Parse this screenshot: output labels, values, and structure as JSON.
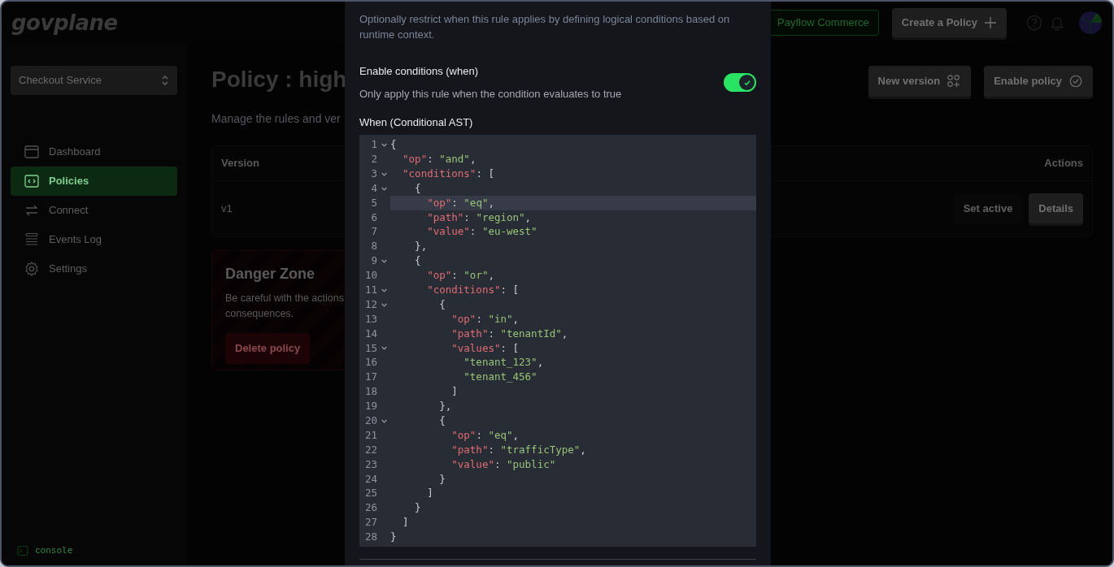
{
  "header": {
    "logo": "govplane",
    "org_badge": "Payflow Commerce",
    "create_button": "Create a Policy"
  },
  "sidebar": {
    "project_select": "Checkout Service",
    "items": [
      {
        "label": "Dashboard",
        "selected": false
      },
      {
        "label": "Policies",
        "selected": true
      },
      {
        "label": "Connect",
        "selected": false
      },
      {
        "label": "Events Log",
        "selected": false
      },
      {
        "label": "Settings",
        "selected": false
      }
    ],
    "console": "console"
  },
  "main": {
    "title": "Policy : high",
    "subtitle": "Manage the rules and ver",
    "buttons": [
      "New version",
      "Enable policy"
    ],
    "table": {
      "columns": [
        "Version",
        "Actions"
      ],
      "rows": [
        {
          "version": "v1",
          "actions": [
            "Set active",
            "Details"
          ]
        }
      ]
    },
    "danger_zone": {
      "title": "Danger Zone",
      "text_lines": [
        "Be careful with the actions",
        "consequences."
      ],
      "button": "Delete policy"
    }
  },
  "modal": {
    "description": "Optionally restrict when this rule applies by defining logical conditions based on runtime context.",
    "toggle": {
      "label": "Enable conditions (when)",
      "hint": "Only apply this rule when the condition evaluates to true",
      "on": true
    },
    "editor": {
      "label": "When (Conditional AST)",
      "lines": [
        {
          "n": "1",
          "text": "{",
          "fold": true,
          "active": false
        },
        {
          "n": "2",
          "text": "  \"op\": \"and\",",
          "fold": false,
          "active": false
        },
        {
          "n": "3",
          "text": "  \"conditions\": [",
          "fold": true,
          "active": false
        },
        {
          "n": "4",
          "text": "    {",
          "fold": true,
          "active": false
        },
        {
          "n": "5",
          "text": "      \"op\": \"eq\",",
          "fold": false,
          "active": true
        },
        {
          "n": "6",
          "text": "      \"path\": \"region\",",
          "fold": false,
          "active": false
        },
        {
          "n": "7",
          "text": "      \"value\": \"eu-west\"",
          "fold": false,
          "active": false
        },
        {
          "n": "8",
          "text": "    },",
          "fold": false,
          "active": false
        },
        {
          "n": "9",
          "text": "    {",
          "fold": true,
          "active": false
        },
        {
          "n": "10",
          "text": "      \"op\": \"or\",",
          "fold": false,
          "active": false
        },
        {
          "n": "11",
          "text": "      \"conditions\": [",
          "fold": true,
          "active": false
        },
        {
          "n": "12",
          "text": "        {",
          "fold": true,
          "active": false
        },
        {
          "n": "13",
          "text": "          \"op\": \"in\",",
          "fold": false,
          "active": false
        },
        {
          "n": "14",
          "text": "          \"path\": \"tenantId\",",
          "fold": false,
          "active": false
        },
        {
          "n": "15",
          "text": "          \"values\": [",
          "fold": true,
          "active": false
        },
        {
          "n": "16",
          "text": "            \"tenant_123\",",
          "fold": false,
          "active": false
        },
        {
          "n": "17",
          "text": "            \"tenant_456\"",
          "fold": false,
          "active": false
        },
        {
          "n": "18",
          "text": "          ]",
          "fold": false,
          "active": false
        },
        {
          "n": "19",
          "text": "        },",
          "fold": false,
          "active": false
        },
        {
          "n": "20",
          "text": "        {",
          "fold": true,
          "active": false
        },
        {
          "n": "21",
          "text": "          \"op\": \"eq\",",
          "fold": false,
          "active": false
        },
        {
          "n": "22",
          "text": "          \"path\": \"trafficType\",",
          "fold": false,
          "active": false
        },
        {
          "n": "23",
          "text": "          \"value\": \"public\"",
          "fold": false,
          "active": false
        },
        {
          "n": "24",
          "text": "        }",
          "fold": false,
          "active": false
        },
        {
          "n": "25",
          "text": "      ]",
          "fold": false,
          "active": false
        },
        {
          "n": "26",
          "text": "    }",
          "fold": false,
          "active": false
        },
        {
          "n": "27",
          "text": "  ]",
          "fold": false,
          "active": false
        },
        {
          "n": "28",
          "text": "}",
          "fold": false,
          "active": false
        }
      ]
    }
  }
}
